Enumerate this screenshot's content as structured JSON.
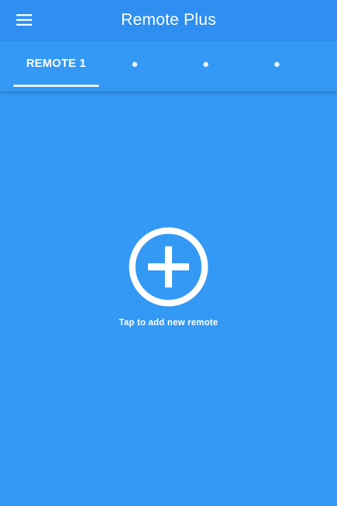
{
  "app_bar": {
    "title": "Remote Plus",
    "menu_icon": "menu-icon"
  },
  "tabs": [
    {
      "label": "REMOTE 1",
      "selected": true
    },
    {
      "label": "",
      "placeholder_icon": "dot-icon"
    },
    {
      "label": "",
      "placeholder_icon": "dot-icon"
    },
    {
      "label": "",
      "placeholder_icon": "dot-icon"
    }
  ],
  "empty_state": {
    "icon": "add-circle-icon",
    "hint": "Tap to add new remote"
  },
  "colors": {
    "background": "#3399f5",
    "app_bar": "#2e8ff0",
    "foreground": "#ffffff"
  }
}
